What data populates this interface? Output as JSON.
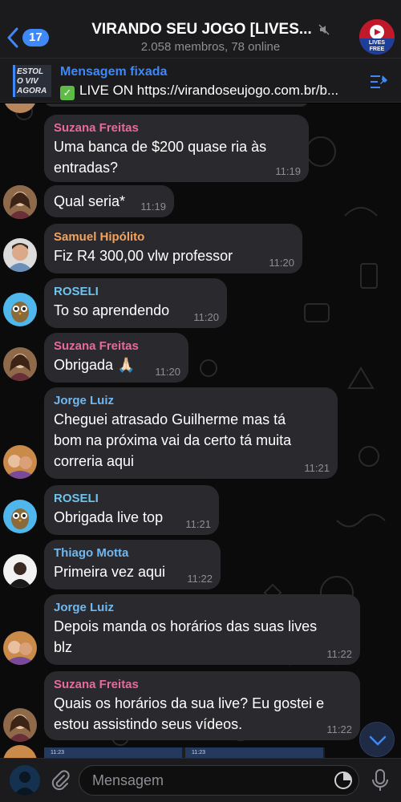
{
  "header": {
    "unread_count": "17",
    "title": "VIRANDO SEU JOGO [LIVES...",
    "subtitle": "2.058 membros, 78 online",
    "avatar_lines": [
      "LIVES",
      "FREE"
    ]
  },
  "pinned": {
    "label": "Mensagem fixada",
    "text": "LIVE ON https://virandoseujogo.com.br/b...",
    "thumb_lines": [
      "ESTOL",
      "O VIV",
      "AGORA"
    ]
  },
  "messages": [
    {
      "sender": "Suzana Freitas",
      "sender_color": "#e86a9d",
      "text": "Uma banca de $200 quase ria às entradas?",
      "time": "11:19"
    },
    {
      "sender": "",
      "sender_color": "",
      "text": "Qual seria*",
      "time": "11:19"
    },
    {
      "sender": "Samuel Hipólito",
      "sender_color": "#f3a35d",
      "text": "Fiz R4 300,00 vlw professor",
      "time": "11:20"
    },
    {
      "sender": "ROSELI",
      "sender_color": "#6fc3ec",
      "text": "To so aprendendo",
      "time": "11:20"
    },
    {
      "sender": "Suzana Freitas",
      "sender_color": "#e86a9d",
      "text": "Obrigada 🙏🏻",
      "time": "11:20"
    },
    {
      "sender": "Jorge Luiz",
      "sender_color": "#6fb8f2",
      "text": "Cheguei atrasado Guilherme mas tá bom na próxima vai da certo tá muita correria aqui",
      "time": "11:21"
    },
    {
      "sender": "ROSELI",
      "sender_color": "#6fc3ec",
      "text": "Obrigada live top",
      "time": "11:21"
    },
    {
      "sender": "Thiago Motta",
      "sender_color": "#6fb8f2",
      "text": "Primeira vez aqui",
      "time": "11:22"
    },
    {
      "sender": "Jorge Luiz",
      "sender_color": "#6fb8f2",
      "text": "Depois manda os horários das suas lives blz",
      "time": "11:22"
    },
    {
      "sender": "Suzana Freitas",
      "sender_color": "#e86a9d",
      "text": "Quais os horários da sua live?  Eu gostei e estou assistindo seus vídeos.",
      "time": "11:22"
    }
  ],
  "previews": [
    "11:23",
    "11:23"
  ],
  "input": {
    "placeholder": "Mensagem"
  },
  "colors": {
    "accent": "#3e88f7",
    "bubble": "#2a292d",
    "header_bg": "#1b1b1d"
  }
}
